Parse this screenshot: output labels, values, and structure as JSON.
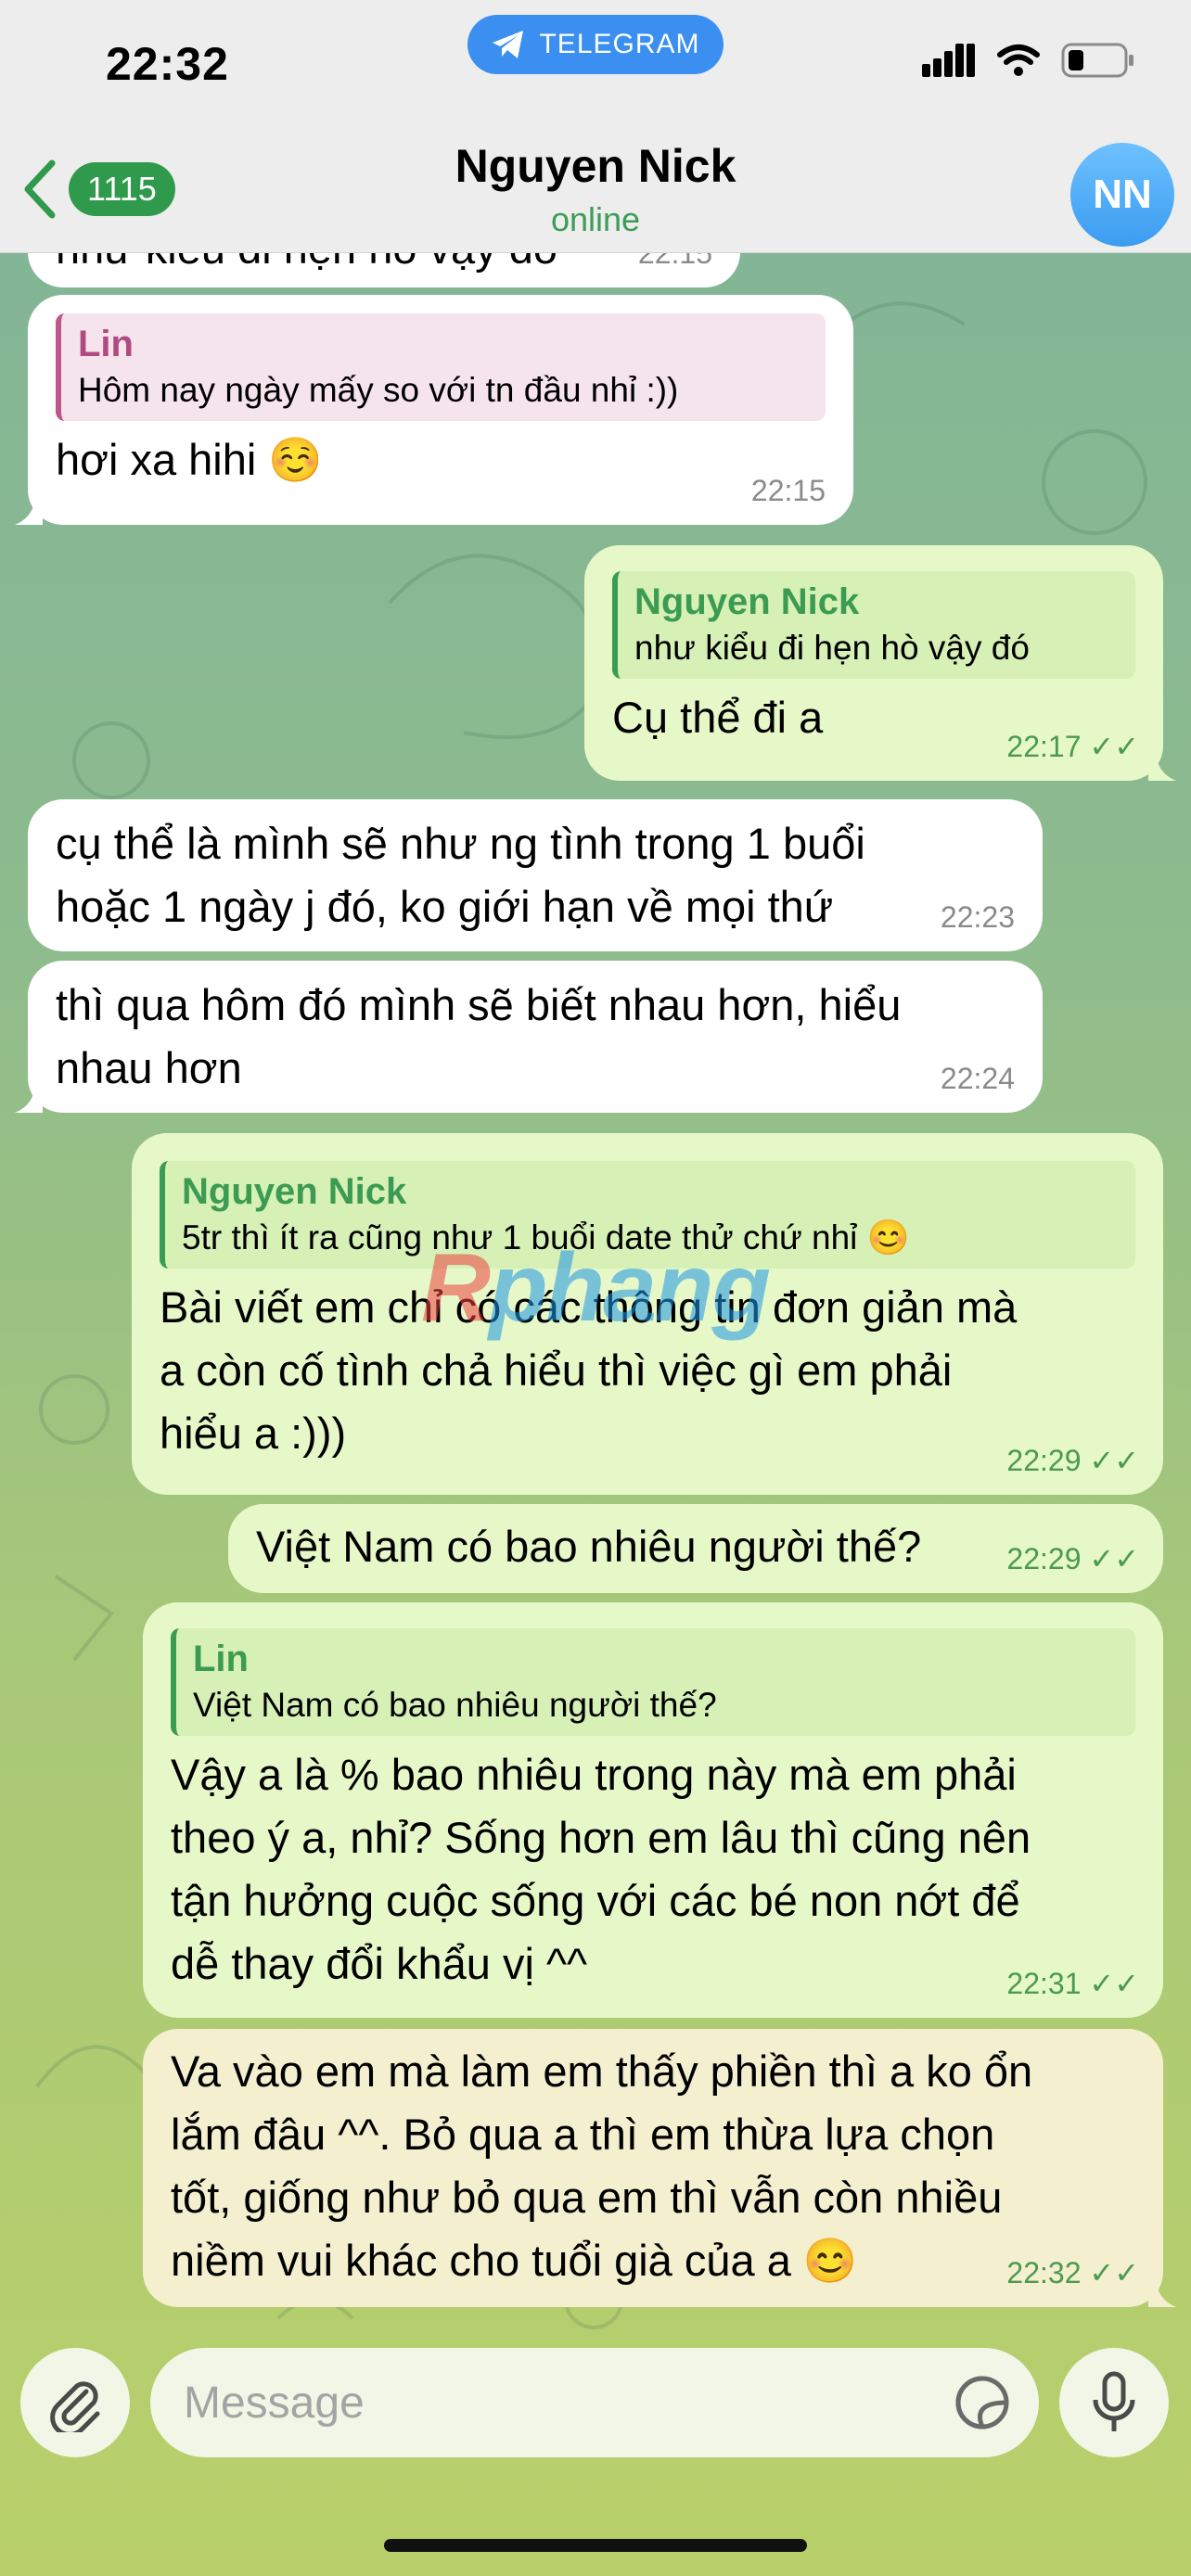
{
  "status_bar": {
    "time": "22:32",
    "app_pill": "TELEGRAM"
  },
  "header": {
    "unread_count": "1115",
    "contact_name": "Nguyen Nick",
    "status": "online",
    "avatar_initials": "NN"
  },
  "messages": [
    {
      "side": "in",
      "text": "như kiểu đi hẹn hò vậy đó",
      "time": "22:15"
    },
    {
      "side": "in",
      "reply_name": "Lin",
      "reply_text": "Hôm nay ngày mấy so với tn đầu nhỉ :))",
      "text": "hơi xa hihi ☺️",
      "time": "22:15"
    },
    {
      "side": "out",
      "reply_name": "Nguyen Nick",
      "reply_text": "như kiểu đi hẹn hò vậy đó",
      "text": "Cụ thể đi a",
      "time": "22:17"
    },
    {
      "side": "in",
      "text_lines": [
        "cụ thể là mình sẽ như ng tình trong 1 buổi",
        "hoặc 1 ngày j đó, ko giới hạn về mọi thứ"
      ],
      "time": "22:23"
    },
    {
      "side": "in",
      "text_lines": [
        "thì qua hôm đó mình sẽ biết nhau hơn, hiểu",
        "nhau hơn"
      ],
      "time": "22:24"
    },
    {
      "side": "out",
      "reply_name": "Nguyen Nick",
      "reply_text": "5tr thì ít ra cũng như 1 buổi date thử chứ nhỉ 😊",
      "text_lines": [
        "Bài viết em chỉ có các thông tin đơn giản mà",
        "a còn cố tình chả hiểu thì việc gì em phải",
        "hiểu a :)))"
      ],
      "time": "22:29"
    },
    {
      "side": "out",
      "text": "Việt Nam có bao nhiêu người thế?",
      "time": "22:29"
    },
    {
      "side": "out",
      "reply_name": "Lin",
      "reply_text": "Việt Nam có bao nhiêu người thế?",
      "text_lines": [
        "Vậy a là % bao nhiêu trong này mà em phải",
        "theo ý a, nhỉ? Sống hơn em lâu thì cũng nên",
        "tận hưởng cuộc sống với các bé non nớt để",
        "dễ thay đổi khẩu vị ^^"
      ],
      "time": "22:31"
    },
    {
      "side": "out",
      "text_lines": [
        "Va vào em mà làm em thấy phiền thì a ko ổn",
        "lắm đâu ^^. Bỏ qua a thì em thừa lựa chọn",
        "tốt, giống như bỏ qua em thì vẫn còn nhiều",
        "niềm vui khác cho tuổi già của a 😊"
      ],
      "time": "22:32"
    }
  ],
  "input": {
    "placeholder": "Message"
  },
  "watermark": {
    "part1": "R",
    "part2": "phang"
  },
  "colors": {
    "accent": "#3a8ff0",
    "outgoing_bubble": "#e6f8c8",
    "incoming_bubble": "#ffffff",
    "badge": "#2f9a4c"
  }
}
